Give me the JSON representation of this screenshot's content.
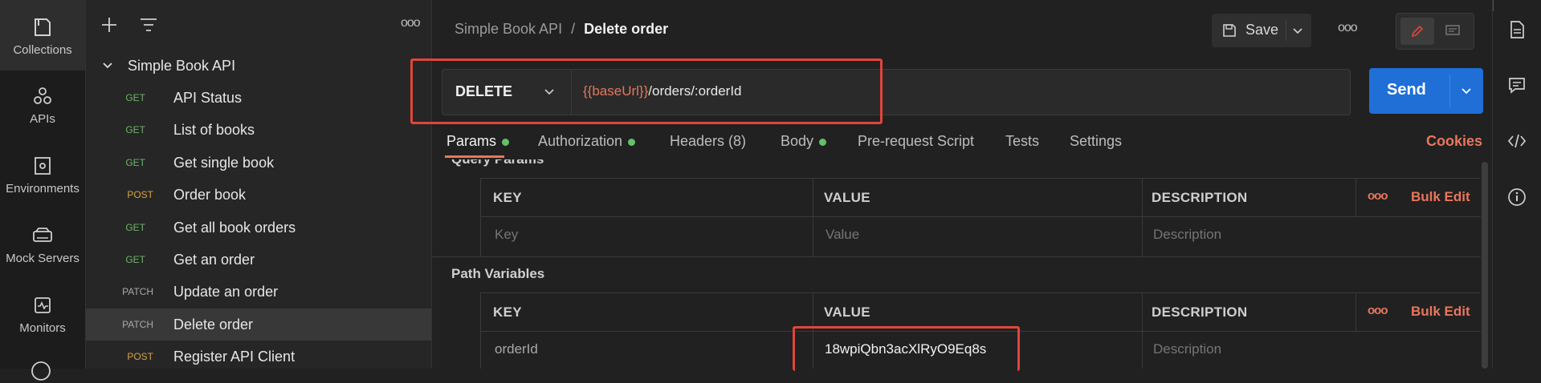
{
  "rail": {
    "items": [
      {
        "label": "Collections",
        "icon": "collections-icon"
      },
      {
        "label": "APIs",
        "icon": "apis-icon"
      },
      {
        "label": "Environments",
        "icon": "environments-icon"
      },
      {
        "label": "Mock Servers",
        "icon": "mock-servers-icon"
      },
      {
        "label": "Monitors",
        "icon": "monitors-icon"
      }
    ]
  },
  "collection": {
    "name": "Simple Book API",
    "requests": [
      {
        "method": "GET",
        "name": "API Status"
      },
      {
        "method": "GET",
        "name": "List of books"
      },
      {
        "method": "GET",
        "name": "Get single book"
      },
      {
        "method": "POST",
        "name": "Order book"
      },
      {
        "method": "GET",
        "name": "Get all book orders"
      },
      {
        "method": "GET",
        "name": "Get an order"
      },
      {
        "method": "PATCH",
        "name": "Update an order"
      },
      {
        "method": "PATCH",
        "name": "Delete order"
      },
      {
        "method": "POST",
        "name": "Register API Client"
      }
    ]
  },
  "breadcrumb": {
    "parent": "Simple Book API",
    "separator": "/",
    "current": "Delete order"
  },
  "toolbar": {
    "save_label": "Save",
    "more_label": "ooo"
  },
  "request": {
    "method": "DELETE",
    "url_variable": "{{baseUrl}}",
    "url_path": "/orders/:orderId",
    "send_label": "Send"
  },
  "tabs": [
    {
      "label": "Params",
      "dot": true
    },
    {
      "label": "Authorization",
      "dot": true
    },
    {
      "label": "Headers (8)",
      "dot": false
    },
    {
      "label": "Body",
      "dot": true
    },
    {
      "label": "Pre-request Script",
      "dot": false
    },
    {
      "label": "Tests",
      "dot": false
    },
    {
      "label": "Settings",
      "dot": false
    }
  ],
  "cookies_label": "Cookies",
  "query_params": {
    "title": "Query Params",
    "headers": {
      "key": "KEY",
      "value": "VALUE",
      "description": "DESCRIPTION"
    },
    "more": "ooo",
    "bulk_edit": "Bulk Edit",
    "placeholders": {
      "key": "Key",
      "value": "Value",
      "description": "Description"
    }
  },
  "path_variables": {
    "title": "Path Variables",
    "headers": {
      "key": "KEY",
      "value": "VALUE",
      "description": "DESCRIPTION"
    },
    "more": "ooo",
    "bulk_edit": "Bulk Edit",
    "rows": [
      {
        "key": "orderId",
        "value": "18wpiQbn3acXlRyO9Eq8s",
        "description_placeholder": "Description"
      }
    ]
  },
  "colors": {
    "accent_orange": "#e8765c",
    "send_blue": "#1f6fd6",
    "highlight_red": "#e0453a",
    "dot_green": "#62c26a"
  }
}
